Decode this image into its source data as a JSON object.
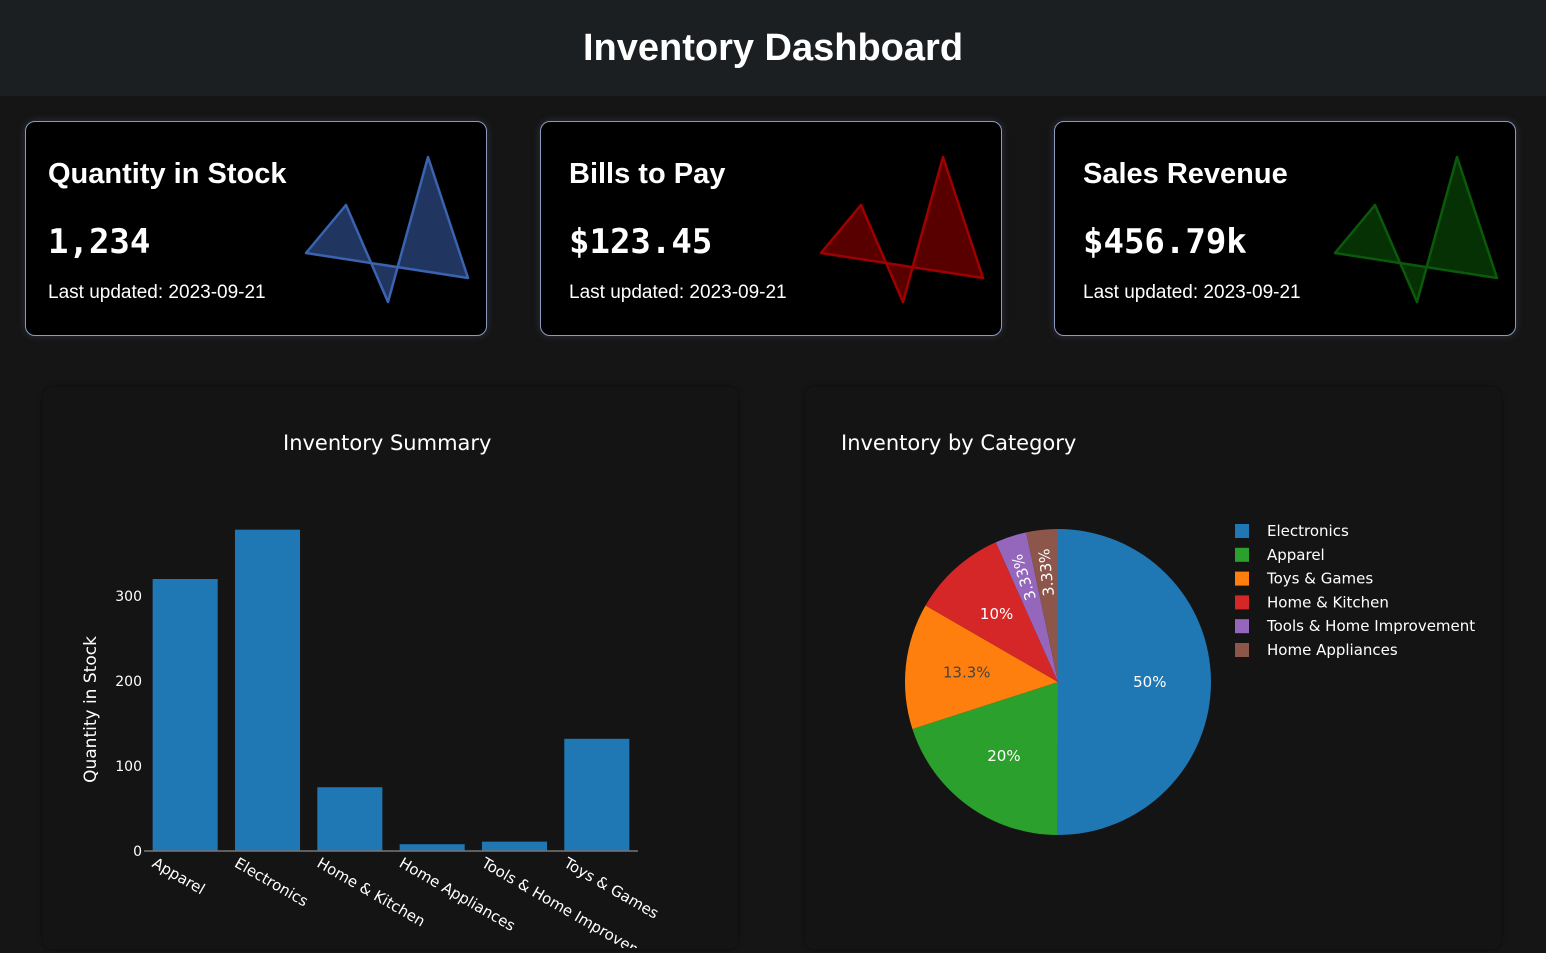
{
  "header": {
    "title": "Inventory Dashboard"
  },
  "cards": [
    {
      "title": "Quantity in Stock",
      "value": "1,234",
      "updated": "Last updated: 2023-09-21",
      "color": "#4a7fe8",
      "spark_color": "#3a63b0"
    },
    {
      "title": "Bills to Pay",
      "value": "$123.45",
      "updated": "Last updated: 2023-09-21",
      "color": "#ee1111",
      "spark_color": "#a00000"
    },
    {
      "title": "Sales Revenue",
      "value": "$456.79k",
      "updated": "Last updated: 2023-09-21",
      "color": "#1a8a1a",
      "spark_color": "#0a5a0a"
    }
  ],
  "chart_data": [
    {
      "type": "bar",
      "title": "Inventory Summary",
      "ylabel": "Quantity in Stock",
      "xlabel": "",
      "categories": [
        "Apparel",
        "Electronics",
        "Home & Kitchen",
        "Home Appliances",
        "Tools & Home Improvement",
        "Toys & Games"
      ],
      "values": [
        320,
        378,
        75,
        8,
        11,
        132
      ],
      "ylim": [
        0,
        380
      ],
      "yticks": [
        0,
        100,
        200,
        300
      ],
      "color": "#1f77b4"
    },
    {
      "type": "pie",
      "title": "Inventory by Category",
      "labels": [
        "Electronics",
        "Apparel",
        "Toys & Games",
        "Home & Kitchen",
        "Tools & Home Improvement",
        "Home Appliances"
      ],
      "values": [
        50,
        20,
        13.3,
        10,
        3.33,
        3.33
      ],
      "display": [
        "50%",
        "20%",
        "13.3%",
        "10%",
        "3.33%",
        "3.33%"
      ],
      "colors": [
        "#1f77b4",
        "#2ca02c",
        "#ff7f0e",
        "#d62728",
        "#9467bd",
        "#8c564b"
      ],
      "legend": "right"
    }
  ]
}
